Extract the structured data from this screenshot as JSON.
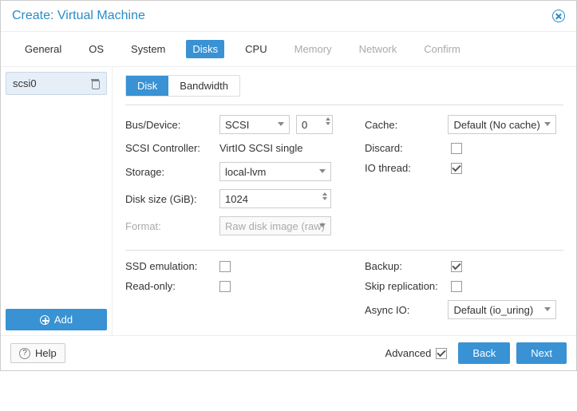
{
  "dialog": {
    "title": "Create: Virtual Machine"
  },
  "tabs": {
    "general": "General",
    "os": "OS",
    "system": "System",
    "disks": "Disks",
    "cpu": "CPU",
    "memory": "Memory",
    "network": "Network",
    "confirm": "Confirm"
  },
  "sidebar": {
    "items": [
      {
        "label": "scsi0"
      }
    ],
    "add": "Add"
  },
  "subtabs": {
    "disk": "Disk",
    "bandwidth": "Bandwidth"
  },
  "form": {
    "bus_device_label": "Bus/Device:",
    "bus_value": "SCSI",
    "device_value": "0",
    "scsi_controller_label": "SCSI Controller:",
    "scsi_controller_value": "VirtIO SCSI single",
    "storage_label": "Storage:",
    "storage_value": "local-lvm",
    "disk_size_label": "Disk size (GiB):",
    "disk_size_value": "1024",
    "format_label": "Format:",
    "format_value": "Raw disk image (raw)",
    "cache_label": "Cache:",
    "cache_value": "Default (No cache)",
    "discard_label": "Discard:",
    "io_thread_label": "IO thread:",
    "ssd_emulation_label": "SSD emulation:",
    "read_only_label": "Read-only:",
    "backup_label": "Backup:",
    "skip_replication_label": "Skip replication:",
    "async_io_label": "Async IO:",
    "async_io_value": "Default (io_uring)"
  },
  "footer": {
    "help": "Help",
    "advanced": "Advanced",
    "back": "Back",
    "next": "Next"
  }
}
